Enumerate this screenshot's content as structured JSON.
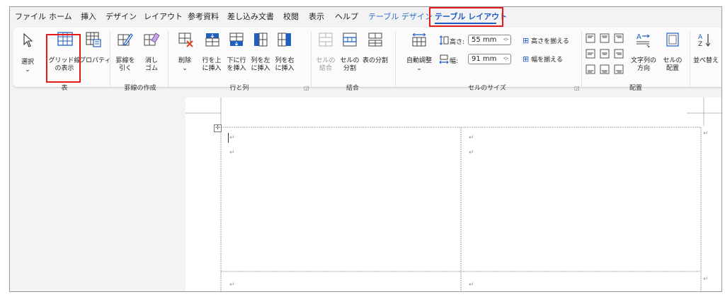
{
  "tabs": [
    {
      "label": "ファイル"
    },
    {
      "label": "ホーム"
    },
    {
      "label": "挿入"
    },
    {
      "label": "デザイン"
    },
    {
      "label": "レイアウト"
    },
    {
      "label": "参考資料"
    },
    {
      "label": "差し込み文書"
    },
    {
      "label": "校閲"
    },
    {
      "label": "表示"
    },
    {
      "label": "ヘルプ"
    },
    {
      "label": "テーブル デザイン"
    },
    {
      "label": "テーブル レイアウト"
    }
  ],
  "groups": {
    "table": {
      "label": "表",
      "select": "選択",
      "gridlines_line1": "グリッド線",
      "gridlines_line2": "の表示",
      "properties": "プロパティ"
    },
    "draw": {
      "label": "罫線の作成",
      "draw_line1": "罫線を",
      "draw_line2": "引く",
      "eraser_line1": "消し",
      "eraser_line2": "ゴム"
    },
    "rows_cols": {
      "label": "行と列",
      "delete": "削除",
      "above_line1": "行を上",
      "above_line2": "に挿入",
      "below_line1": "下に行",
      "below_line2": "を挿入",
      "left_line1": "列を左",
      "left_line2": "に挿入",
      "right_line1": "列を右",
      "right_line2": "に挿入"
    },
    "merge": {
      "label": "結合",
      "merge_line1": "セルの",
      "merge_line2": "結合",
      "split_line1": "セルの",
      "split_line2": "分割",
      "split_table": "表の分割"
    },
    "cell_size": {
      "label": "セルのサイズ",
      "autofit": "自動調整",
      "height_label": "高さ:",
      "height_value": "55 mm",
      "width_label": "幅:",
      "width_value": "91 mm",
      "distribute_rows": "高さを揃える",
      "distribute_cols": "幅を揃える"
    },
    "alignment": {
      "label": "配置",
      "text_dir_line1": "文字列の",
      "text_dir_line2": "方向",
      "margins_line1": "セルの",
      "margins_line2": "配置"
    },
    "sort": {
      "label": "並べ替え"
    }
  },
  "colors": {
    "accent": "#1d5bc0",
    "highlight": "#e41a1a",
    "icon_blue": "#1f5fbf",
    "icon_red": "#d24726"
  }
}
